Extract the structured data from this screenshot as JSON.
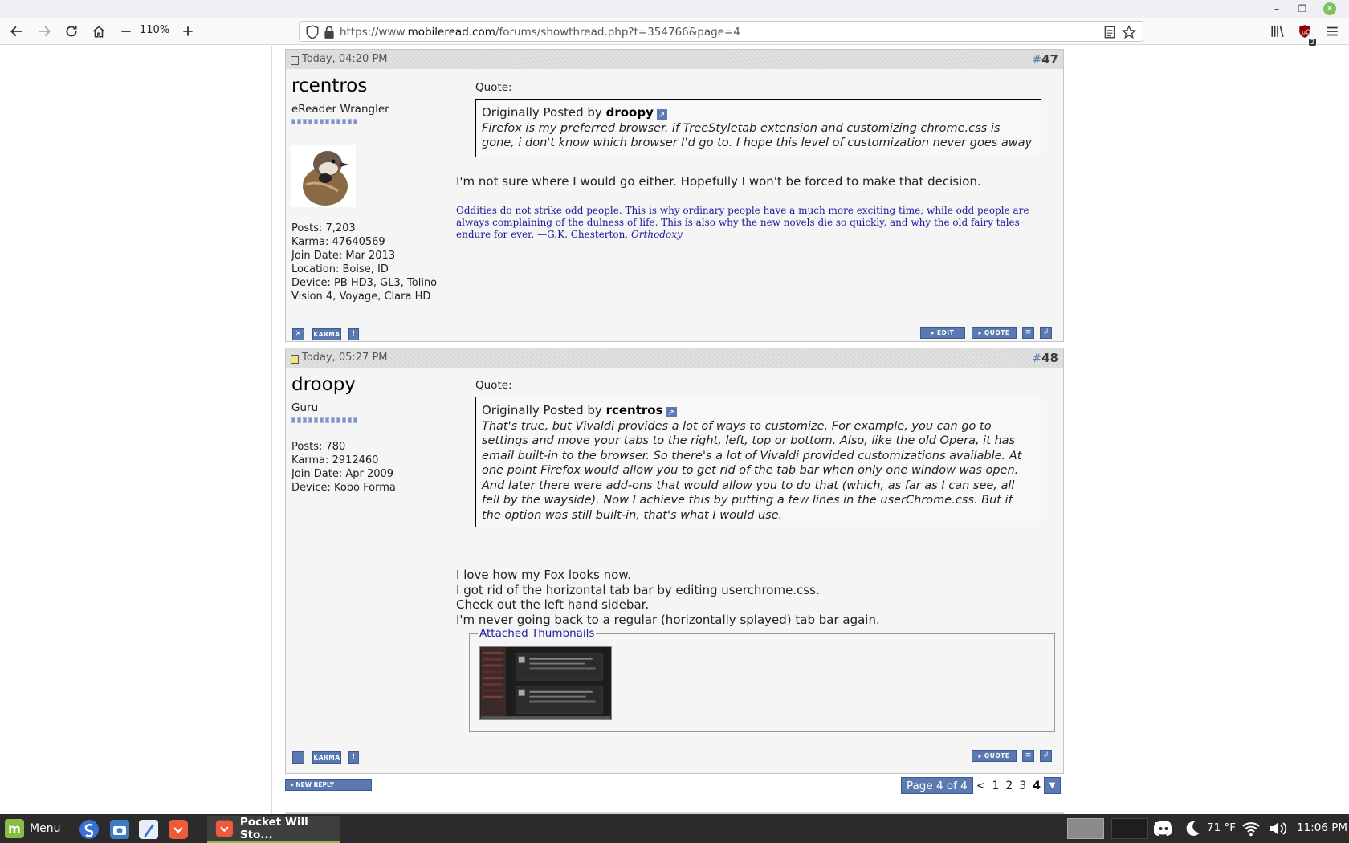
{
  "browser": {
    "zoom": "110%",
    "url": {
      "scheme": "https://www.",
      "domain": "mobileread.com",
      "path": "/forums/showthread.php?t=354766&page=4"
    },
    "icons": {
      "back": "back-arrow-icon",
      "forward": "forward-arrow-icon",
      "reload": "reload-icon",
      "home": "home-icon",
      "zoom_out": "minus-icon",
      "zoom_in": "plus-icon",
      "shield": "shield-icon",
      "lock": "lock-icon",
      "reader": "reader-view-icon",
      "bookmark": "star-icon",
      "library": "library-icon",
      "ublock": "ublock-icon",
      "menu": "hamburger-icon"
    },
    "ublock_badge": "2"
  },
  "posts": [
    {
      "date": "Today, 04:20 PM",
      "number_prefix": "#",
      "number": "47",
      "author": {
        "name": "rcentros",
        "title": "eReader Wrangler",
        "info": [
          "Posts: 7,203",
          "Karma: 47640569",
          "Join Date: Mar 2013",
          "Location: Boise, ID",
          "Device: PB HD3, GL3, Tolino Vision 4, Voyage, Clara HD"
        ]
      },
      "quote": {
        "label": "Quote:",
        "prefix": "Originally Posted by",
        "by": "droopy",
        "text": "Firefox is my preferred browser. if TreeStyletab extension and customizing chrome.css is gone, i don't know which browser I'd go to. I hope this level of customization never goes away"
      },
      "message": [
        "I'm not sure where I would go either. Hopefully I won't be forced to make that decision."
      ],
      "signature": {
        "text": "Oddities do not strike odd people. This is why ordinary people have a much more exciting time; while odd people are always complaining of the dulness of life. This is also why the new novels die so quickly, and why the old fairy tales endure for ever. —G.K. Chesterton,",
        "source": "Orthodoxy"
      },
      "buttons": {
        "karma": "KARMA",
        "edit": "▸ EDIT",
        "quote": "▸ QUOTE"
      }
    },
    {
      "date": "Today, 05:27 PM",
      "number_prefix": "#",
      "number": "48",
      "author": {
        "name": "droopy",
        "title": "Guru",
        "info": [
          "Posts: 780",
          "Karma: 2912460",
          "Join Date: Apr 2009",
          "Device: Kobo Forma"
        ]
      },
      "quote": {
        "label": "Quote:",
        "prefix": "Originally Posted by",
        "by": "rcentros",
        "text": "That's true, but Vivaldi provides a lot of ways to customize. For example, you can go to settings and move your tabs to the right, left, top or bottom. Also, like the old Opera, it has email built-in to the browser. So there's a lot of Vivaldi provided customizations available. At one point Firefox would allow you to get rid of the tab bar when only one window was open. And later there were add-ons that would allow you to do that (which, as far as I can see, all fell by the wayside). Now I achieve this by putting a few lines in the userChrome.css. But if the option was still built-in, that's what I would use."
      },
      "message": [
        "I love how my Fox looks now.",
        "I got rid of the horizontal tab bar by editing userchrome.css.",
        "Check out the left hand sidebar.",
        "I'm never going back to a regular (horizontally splayed) tab bar again."
      ],
      "attachments_label": "Attached Thumbnails",
      "buttons": {
        "karma": "KARMA",
        "quote": "▸ QUOTE"
      }
    }
  ],
  "footer": {
    "new_reply": "▸ NEW REPLY",
    "pager": {
      "label": "Page 4 of 4",
      "prev": "<",
      "pages": [
        "1",
        "2",
        "3",
        "4"
      ],
      "current": "4"
    }
  },
  "taskbar": {
    "menu_label": "Menu",
    "task_label": "Pocket Will Sto...",
    "temperature": "71 °F",
    "clock": "11:06 PM"
  }
}
